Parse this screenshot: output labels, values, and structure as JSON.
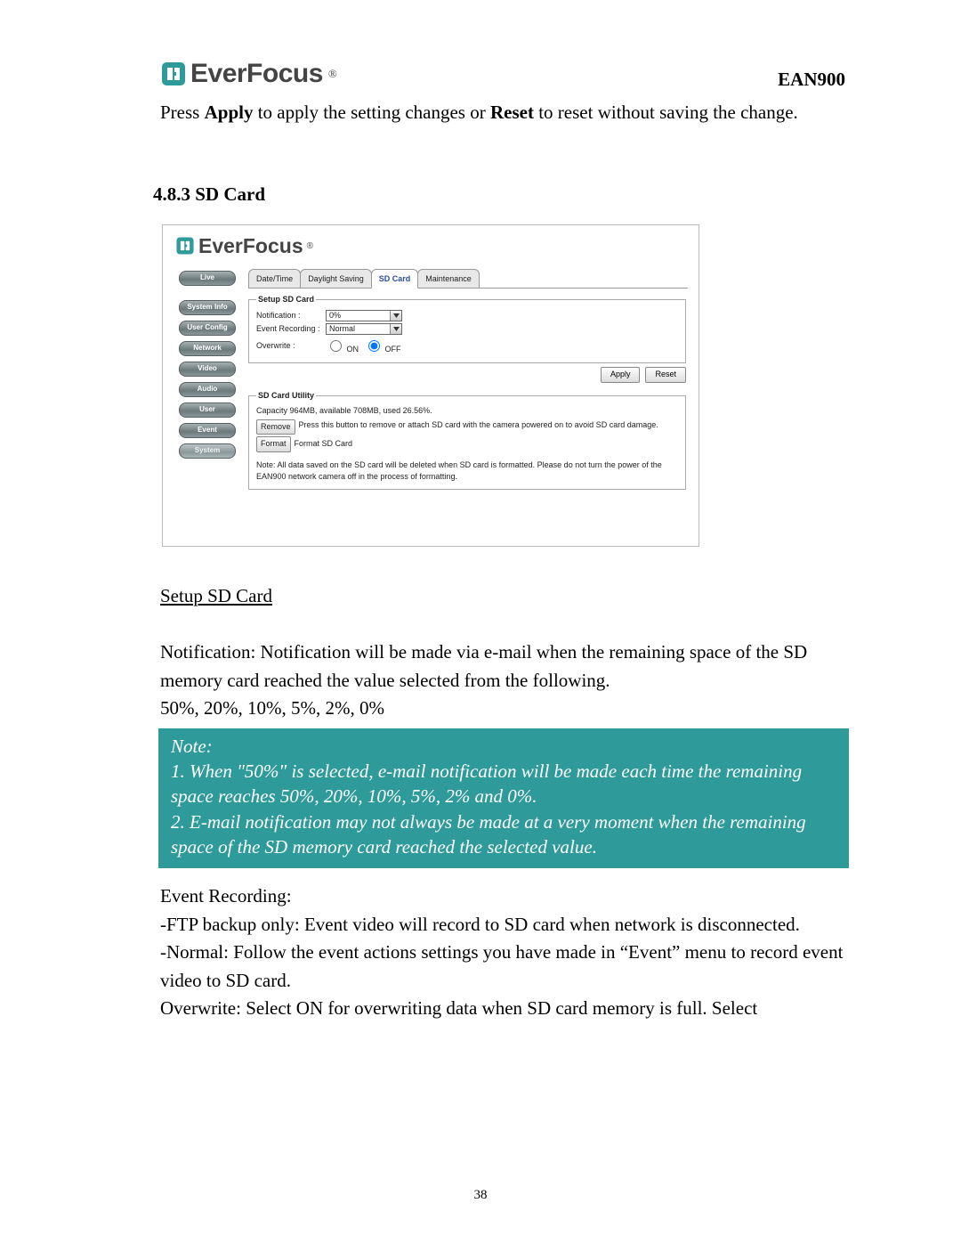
{
  "header": {
    "brand": "EverFocus",
    "reg": "®",
    "model": "EAN900"
  },
  "intro": {
    "prefix": "Press ",
    "apply_word": "Apply",
    "mid": " to apply the setting changes or ",
    "reset_word": "Reset",
    "suffix": " to reset without saving the change."
  },
  "section_heading": "4.8.3 SD Card",
  "screenshot": {
    "brand": "EverFocus",
    "nav": {
      "live": "Live",
      "system_info": "System Info",
      "user_config": "User Config",
      "network": "Network",
      "video": "Video",
      "audio": "Audio",
      "user": "User",
      "event": "Event",
      "system": "System"
    },
    "tabs": {
      "date_time": "Date/Time",
      "daylight_saving": "Daylight Saving",
      "sd_card": "SD Card",
      "maintenance": "Maintenance"
    },
    "setup_panel": {
      "legend": "Setup SD Card",
      "notification_label": "Notification :",
      "notification_value": "0%",
      "event_recording_label": "Event Recording :",
      "event_recording_value": "Normal",
      "overwrite_label": "Overwrite :",
      "overwrite_on": "ON",
      "overwrite_off": "OFF",
      "apply_btn": "Apply",
      "reset_btn": "Reset"
    },
    "utility_panel": {
      "legend": "SD Card Utility",
      "capacity_line": "Capacity 964MB, available 708MB, used 26.56%.",
      "remove_btn": "Remove",
      "remove_text": "Press this button to remove or attach SD card with the camera powered on to avoid SD card damage.",
      "format_btn": "Format",
      "format_text": "Format SD Card",
      "note_text": "Note: All data saved on the SD card will be deleted when SD card is formatted. Please do not turn the power of the EAN900 network camera off in the process of formatting."
    }
  },
  "body": {
    "setup_heading": "Setup SD Card",
    "notification_para": "Notification: Notification will be made via e-mail when the remaining space of the SD memory card reached the value selected from the following.",
    "notification_values": "50%, 20%, 10%, 5%, 2%, 0%",
    "note_title": "Note:",
    "note_line1": "1. When \"50%\" is selected, e-mail notification will be made each time the remaining space reaches 50%, 20%, 10%, 5%, 2% and 0%.",
    "note_line2": "2. E-mail notification may not always be made at a very moment when the remaining space of the SD memory card reached the selected value.",
    "event_recording_label": "Event Recording:",
    "ftp_backup": "-FTP backup only: Event video will record to SD card when network is disconnected.",
    "normal_line": "-Normal: Follow the event actions settings you have made in “Event” menu to record event video to SD card.",
    "overwrite_line": "Overwrite: Select ON for overwriting data when SD card memory is full. Select"
  },
  "page_number": "38"
}
